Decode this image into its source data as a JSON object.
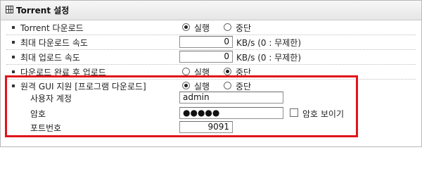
{
  "header": {
    "title": "Torrent 설정",
    "icon": "grid-icon"
  },
  "rows": {
    "torrent_download": {
      "label": "Torrent 다운로드",
      "options": [
        "실행",
        "중단"
      ],
      "selected": "실행"
    },
    "max_download_speed": {
      "label": "최대 다운로드 속도",
      "value": "0",
      "unit": "KB/s (0 : 무제한)"
    },
    "max_upload_speed": {
      "label": "최대 업로드 속도",
      "value": "0",
      "unit": "KB/s (0 : 무제한)"
    },
    "upload_after_complete": {
      "label": "다운로드 완료 후 업로드",
      "options": [
        "실행",
        "중단"
      ],
      "selected": "중단"
    },
    "remote_gui": {
      "label": "원격 GUI 지원 [프로그램 다운로드]",
      "options": [
        "실행",
        "중단"
      ],
      "selected": "실행"
    },
    "username": {
      "label": "사용자 계정",
      "value": "admin"
    },
    "password": {
      "label": "암호",
      "value": "●●●●●",
      "show_label": "암호 보이기",
      "show_checked": false
    },
    "port": {
      "label": "포트번호",
      "value": "9091"
    }
  },
  "colors": {
    "highlight": "#e0141a"
  }
}
